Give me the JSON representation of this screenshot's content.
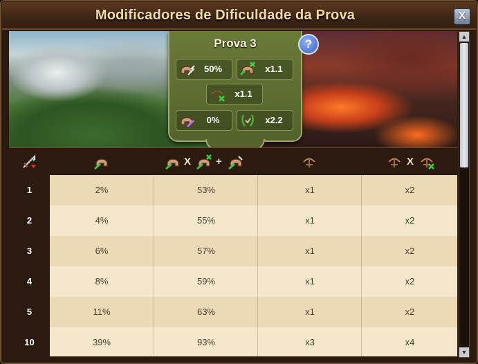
{
  "window": {
    "title": "Modificadores de Dificuldade da Prova",
    "close_label": "X"
  },
  "panel": {
    "title": "Prova 3",
    "help_label": "?",
    "stats": [
      {
        "icon": "helmet-attack-icon",
        "value": "50%"
      },
      {
        "icon": "helmet-defense-icon",
        "value": "x1.1"
      },
      {
        "icon": "crossbow-icon",
        "value": "x1.1"
      },
      {
        "icon": "helmet-magic-icon",
        "value": "0%"
      },
      {
        "icon": "laurel-icon",
        "value": "x2.2"
      }
    ]
  },
  "table": {
    "header_ops": {
      "times": "X",
      "plus": "+"
    },
    "rows": [
      {
        "num": "1",
        "c1": "2%",
        "c2": "53%",
        "c3": "x1",
        "c4": "x2"
      },
      {
        "num": "2",
        "c1": "4%",
        "c2": "55%",
        "c3": "x1",
        "c4": "x2"
      },
      {
        "num": "3",
        "c1": "6%",
        "c2": "57%",
        "c3": "x1",
        "c4": "x2"
      },
      {
        "num": "4",
        "c1": "8%",
        "c2": "59%",
        "c3": "x1",
        "c4": "x2"
      },
      {
        "num": "5",
        "c1": "11%",
        "c2": "63%",
        "c3": "x1",
        "c4": "x2"
      },
      {
        "num": "10",
        "c1": "39%",
        "c2": "93%",
        "c3": "x3",
        "c4": "x4"
      }
    ]
  },
  "scrollbar": {
    "up": "▲",
    "down": "▼"
  },
  "colors": {
    "title": "#f3d9a6",
    "panel": "#6b7a39",
    "row_odd": "#ecd9b5",
    "row_even": "#f4e7cc"
  }
}
